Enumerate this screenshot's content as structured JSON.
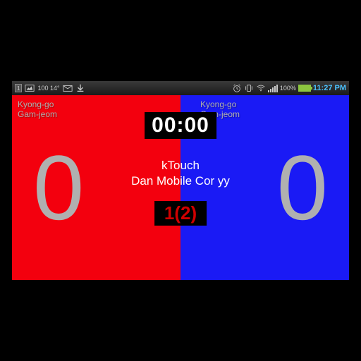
{
  "statusbar": {
    "left_box": "1",
    "temperature": "100 14°",
    "battery_pct": "100%",
    "clock": "11:27 PM"
  },
  "scoreboard": {
    "red": {
      "penalty1": "Kyong-go",
      "penalty2": "Gam-jeom",
      "score": "0"
    },
    "blue": {
      "penalty1": "Kyong-go",
      "penalty2": "Gam-jeom",
      "score": "0"
    },
    "timer": "00:00",
    "app_title": "kTouch",
    "app_subtitle": "Dan Mobile Cor yy",
    "round": "1(2)"
  }
}
